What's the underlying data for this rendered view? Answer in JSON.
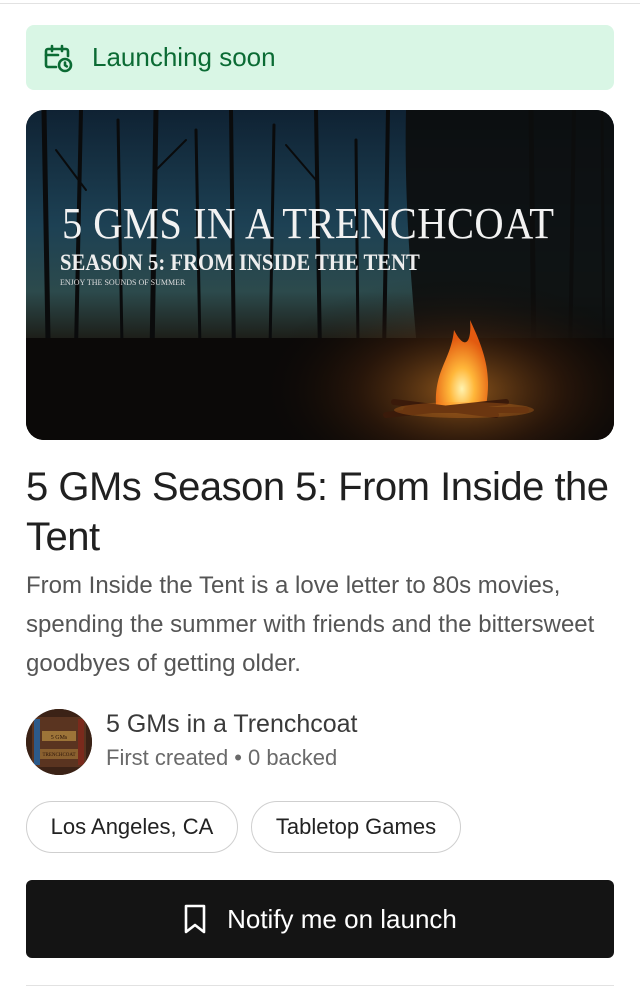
{
  "banner": {
    "label": "Launching soon",
    "icon": "calendar-clock-icon",
    "color": "#0b6b34",
    "background": "#d9f6e5"
  },
  "hero": {
    "title": "5 GMS IN A TRENCHCOAT",
    "subtitle": "SEASON 5: FROM INSIDE THE TENT",
    "tagline": "ENJOY THE SOUNDS OF SUMMER"
  },
  "project": {
    "title": "5 GMs Season 5: From Inside the Tent",
    "description": "From Inside the Tent is a love letter to 80s movies, spending the summer with friends and the bittersweet goodbyes of getting older."
  },
  "creator": {
    "name": "5 GMs in a Trenchcoat",
    "status": "First created",
    "separator": "•",
    "backed": "0 backed",
    "avatar_text_1": "5 GMs",
    "avatar_text_2": "TRENCHCOAT"
  },
  "tags": {
    "location": "Los Angeles, CA",
    "category": "Tabletop Games"
  },
  "actions": {
    "notify_label": "Notify me on launch",
    "notify_icon": "bookmark-icon",
    "button_color": "#141414"
  }
}
